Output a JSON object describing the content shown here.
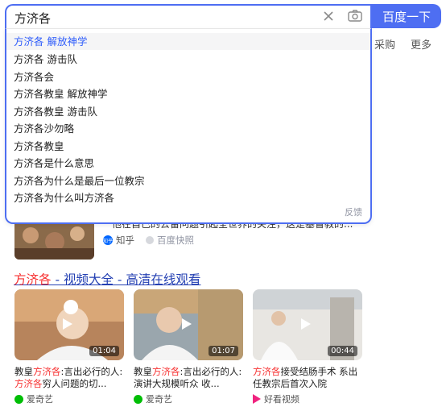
{
  "search": {
    "query": "方济各",
    "button_label": "百度一下"
  },
  "nav": {
    "item_purchase": "采购",
    "item_more": "更多"
  },
  "suggestions": [
    {
      "text": "方济各 解放神学",
      "active": true
    },
    {
      "text": "方济各 游击队",
      "active": false
    },
    {
      "text": "方济各会",
      "active": false
    },
    {
      "text": "方济各教皇 解放神学",
      "active": false
    },
    {
      "text": "方济各教皇 游击队",
      "active": false
    },
    {
      "text": "方济各沙勿略",
      "active": false
    },
    {
      "text": "方济各教皇",
      "active": false
    },
    {
      "text": "方济各是什么意思",
      "active": false
    },
    {
      "text": "方济各为什么是最后一位教宗",
      "active": false
    },
    {
      "text": "方济各为什么叫方济各",
      "active": false
    }
  ],
  "suggestion_feedback": "反馈",
  "partial_result": {
    "snippet": "他在自己的去留问题引起全世界的关注，这是基督教的...",
    "source_name": "知乎",
    "source_logo_text": "知乎",
    "snapshot_label": "百度快照"
  },
  "video_result": {
    "title_highlight": "方济各",
    "title_rest": " - 视频大全 - 高清在线观看",
    "cards": [
      {
        "caption_pre": "教皇",
        "caption_hl": "方济各",
        "caption_mid": ":言出必行的人:",
        "caption_hl2": "方济各",
        "caption_post": "穷人问题的切...",
        "duration": "01:04",
        "source": "爱奇艺",
        "source_icon": "iqiyi-icon"
      },
      {
        "caption_pre": "教皇",
        "caption_hl": "方济各",
        "caption_mid": ":言出必行的人:演讲大规模听众 收...",
        "caption_hl2": "",
        "caption_post": "",
        "duration": "01:07",
        "source": "爱奇艺",
        "source_icon": "iqiyi-icon"
      },
      {
        "caption_pre": "",
        "caption_hl": "方济各",
        "caption_mid": "接受结肠手术 系出任教宗后首次入院",
        "caption_hl2": "",
        "caption_post": "",
        "duration": "00:44",
        "source": "好看视频",
        "source_icon": "haokan-icon"
      }
    ]
  },
  "colors": {
    "accent": "#4e6ef2",
    "link": "#2440b3",
    "highlight": "#f73131"
  }
}
